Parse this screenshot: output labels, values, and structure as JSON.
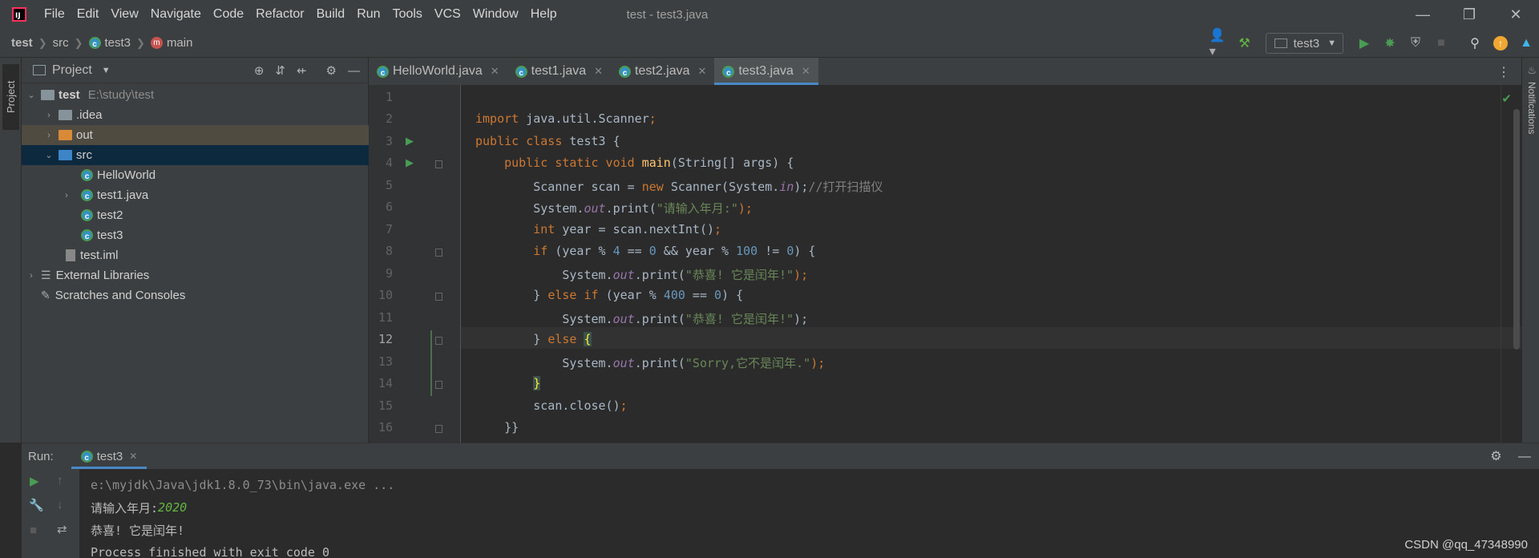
{
  "menu": {
    "items": [
      "File",
      "Edit",
      "View",
      "Navigate",
      "Code",
      "Refactor",
      "Build",
      "Run",
      "Tools",
      "VCS",
      "Window",
      "Help"
    ],
    "window_title": "test - test3.java"
  },
  "breadcrumb": {
    "project": "test",
    "folder": "src",
    "class": "test3",
    "method": "main"
  },
  "toolbar": {
    "run_config": "test3"
  },
  "project_panel": {
    "title": "Project",
    "stripe_label": "Project",
    "tree": [
      {
        "label": "test",
        "sub": "E:\\study\\test"
      },
      {
        "label": ".idea"
      },
      {
        "label": "out"
      },
      {
        "label": "src"
      },
      {
        "label": "HelloWorld"
      },
      {
        "label": "test1.java"
      },
      {
        "label": "test2"
      },
      {
        "label": "test3"
      },
      {
        "label": "test.iml"
      },
      {
        "label": "External Libraries"
      },
      {
        "label": "Scratches and Consoles"
      }
    ]
  },
  "editor": {
    "tabs": [
      "HelloWorld.java",
      "test1.java",
      "test2.java",
      "test3.java"
    ],
    "active_tab": "test3.java",
    "current_line": 12,
    "line_numbers": [
      "1",
      "2",
      "3",
      "4",
      "5",
      "6",
      "7",
      "8",
      "9",
      "10",
      "11",
      "12",
      "13",
      "14",
      "15",
      "16"
    ],
    "code": {
      "l2_a": "import ",
      "l2_b": "java.util.Scanner",
      "l2_c": ";",
      "l3_a": "public class ",
      "l3_b": "test3 {",
      "l4_a": "    public static void ",
      "l4_b": "main",
      "l4_c": "(String[] args) {",
      "l5_a": "        Scanner scan = ",
      "l5_b": "new ",
      "l5_c": "Scanner(System.",
      "l5_d": "in",
      "l5_e": ");",
      "l5_f": "//打开扫描仪",
      "l6_a": "        System.",
      "l6_b": "out",
      "l6_c": ".print(",
      "l6_d": "\"请输入年月:\"",
      "l6_e": ");",
      "l7_a": "        ",
      "l7_b": "int ",
      "l7_c": "year = scan.nextInt()",
      "l7_d": ";",
      "l8_a": "        ",
      "l8_b": "if ",
      "l8_c": "(year % ",
      "l8_d": "4",
      "l8_e": " == ",
      "l8_f": "0",
      "l8_g": " && year % ",
      "l8_h": "100",
      "l8_i": " != ",
      "l8_j": "0",
      "l8_k": ") {",
      "l9_a": "            System.",
      "l9_b": "out",
      "l9_c": ".print(",
      "l9_d": "\"恭喜! 它是闰年!\"",
      "l9_e": ");",
      "l10_a": "        } ",
      "l10_b": "else if ",
      "l10_c": "(year % ",
      "l10_d": "400",
      "l10_e": " == ",
      "l10_f": "0",
      "l10_g": ") {",
      "l11_a": "            System.",
      "l11_b": "out",
      "l11_c": ".print(",
      "l11_d": "\"恭喜! 它是闰年!\"",
      "l11_e": ");",
      "l12_a": "        } ",
      "l12_b": "else ",
      "l12_c": "{",
      "l13_a": "            System.",
      "l13_b": "out",
      "l13_c": ".print(",
      "l13_d": "\"Sorry,它不是闰年.\"",
      "l13_e": ");",
      "l14_a": "        ",
      "l14_b": "}",
      "l15_a": "        scan.close()",
      "l15_b": ";",
      "l16_a": "    }}"
    }
  },
  "run_panel": {
    "label": "Run:",
    "tab": "test3",
    "console": {
      "cmd": "e:\\myjdk\\Java\\jdk1.8.0_73\\bin\\java.exe ...",
      "prompt": "请输入年月:",
      "input": "2020",
      "output": "恭喜! 它是闰年!",
      "exit": "Process finished with exit code 0"
    }
  },
  "notifications_label": "Notifications",
  "watermark": "CSDN @qq_47348990",
  "colors": {
    "keyword": "#cc7832",
    "string": "#6a8759",
    "number": "#6897bb",
    "accent": "#4a88c7"
  }
}
